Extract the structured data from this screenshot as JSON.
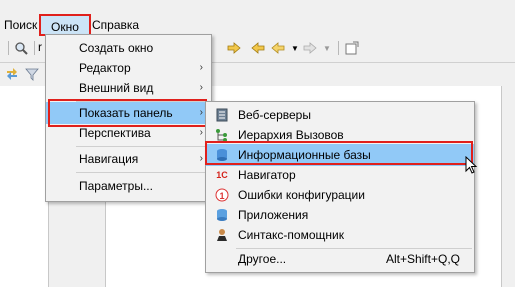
{
  "menubar": {
    "poisk": "Поиск",
    "okno": "Окно",
    "spravka": "Справка"
  },
  "toolbar": {
    "search_text": "r"
  },
  "menu_okno": {
    "items": [
      {
        "label": "Создать окно"
      },
      {
        "label": "Редактор",
        "arrow": "›"
      },
      {
        "label": "Внешний вид",
        "arrow": "›"
      },
      {
        "label": "Показать панель",
        "arrow": "›"
      },
      {
        "label": "Перспектива",
        "arrow": "›"
      },
      {
        "label": "Навигация",
        "arrow": "›"
      },
      {
        "label": "Параметры..."
      }
    ]
  },
  "submenu_panel": {
    "items": [
      {
        "label": "Веб-серверы",
        "icon": "web-servers-icon"
      },
      {
        "label": "Иерархия Вызовов",
        "icon": "call-hierarchy-icon"
      },
      {
        "label": "Информационные базы",
        "icon": "database-icon"
      },
      {
        "label": "Навигатор",
        "icon": "navigator-icon"
      },
      {
        "label": "Ошибки конфигурации",
        "icon": "config-errors-icon"
      },
      {
        "label": "Приложения",
        "icon": "applications-icon"
      },
      {
        "label": "Синтакс-помощник",
        "icon": "syntax-helper-icon"
      },
      {
        "label": "Другое...",
        "shortcut": "Alt+Shift+Q,Q"
      }
    ]
  },
  "colors": {
    "highlight": "#91c9f7",
    "callout": "#e0201c"
  }
}
